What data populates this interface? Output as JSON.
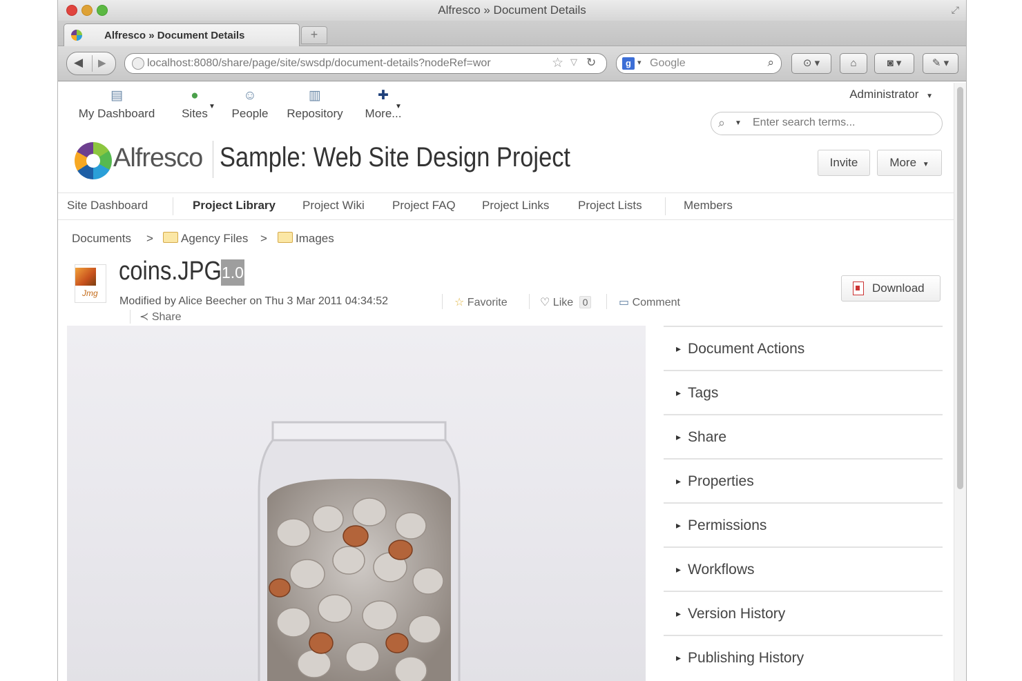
{
  "window": {
    "title": "Alfresco » Document Details",
    "tab_title": "Alfresco » Document Details",
    "new_tab": "+"
  },
  "browser": {
    "url": "localhost:8080/share/page/site/swsdp/document-details?nodeRef=wor",
    "search_engine": "Google",
    "search_placeholder": "Google"
  },
  "app_nav": [
    {
      "label": "My Dashboard",
      "icon": "dashboard-icon"
    },
    {
      "label": "Sites",
      "icon": "sites-icon"
    },
    {
      "label": "People",
      "icon": "people-icon"
    },
    {
      "label": "Repository",
      "icon": "repository-icon"
    },
    {
      "label": "More...",
      "icon": "plus-icon"
    }
  ],
  "user_menu": "Administrator",
  "app_search_placeholder": "Enter search terms...",
  "logo_text": "Alfresco",
  "site_title": "Sample: Web Site Design Project",
  "header_buttons": {
    "invite": "Invite",
    "more": "More"
  },
  "site_nav": [
    "Site Dashboard",
    "Project Library",
    "Project Wiki",
    "Project FAQ",
    "Project Links",
    "Project Lists",
    "Members"
  ],
  "breadcrumb": {
    "root": "Documents",
    "separator": ">",
    "folders": [
      "Agency Files",
      "Images"
    ]
  },
  "document": {
    "name": "coins.JPG",
    "icon_ext": "Jmg",
    "version": "1.0",
    "modified": "Modified by Alice Beecher on Thu 3 Mar 2011 04:34:52",
    "favorite": "Favorite",
    "like": "Like",
    "like_count": "0",
    "comment": "Comment",
    "share": "Share",
    "download": "Download"
  },
  "panels": [
    "Document Actions",
    "Tags",
    "Share",
    "Properties",
    "Permissions",
    "Workflows",
    "Version History",
    "Publishing History"
  ]
}
